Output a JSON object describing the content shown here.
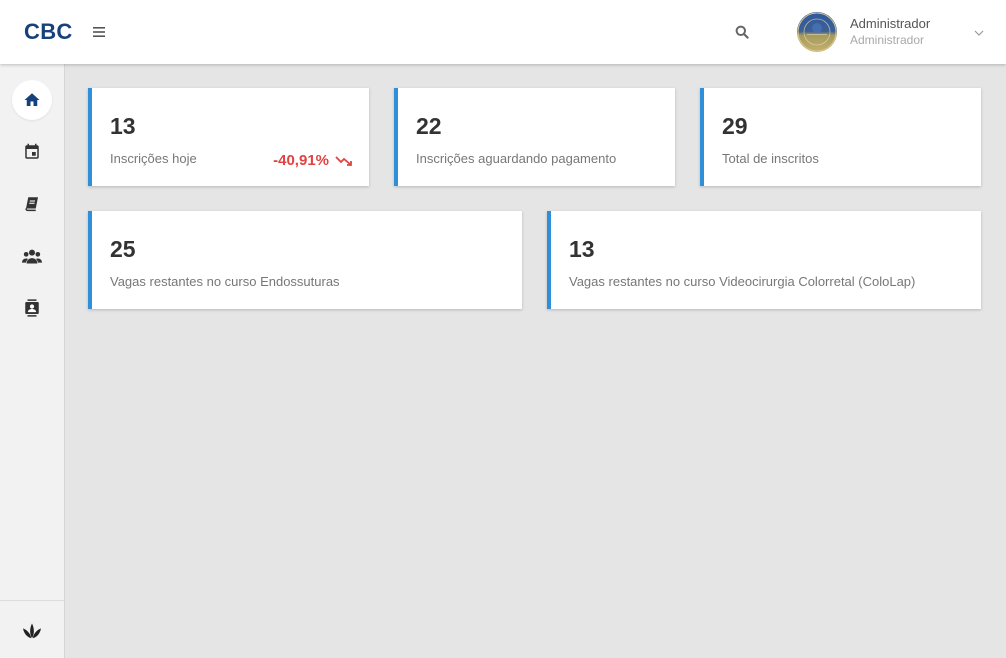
{
  "header": {
    "brand": "CBC",
    "menu_icon": "hamburger-menu-icon",
    "search_icon": "search-icon",
    "user": {
      "name": "Administrador",
      "role": "Administrador",
      "dropdown_icon": "chevron-down-icon"
    }
  },
  "sidebar": {
    "items": [
      {
        "icon": "home-icon",
        "active": true
      },
      {
        "icon": "calendar-icon",
        "active": false
      },
      {
        "icon": "book-icon",
        "active": false
      },
      {
        "icon": "people-group-icon",
        "active": false
      },
      {
        "icon": "contact-card-icon",
        "active": false
      }
    ],
    "footer_icon": "leaf-logo-icon"
  },
  "dashboard": {
    "cards": [
      {
        "value": "13",
        "label": "Inscrições hoje",
        "trend": "-40,91%",
        "trend_icon": "trending-down-icon"
      },
      {
        "value": "22",
        "label": "Inscrições aguardando pagamento"
      },
      {
        "value": "29",
        "label": "Total de inscritos"
      },
      {
        "value": "25",
        "label": "Vagas restantes no curso Endossuturas"
      },
      {
        "value": "13",
        "label": "Vagas restantes no curso Videocirurgia Colorretal (ColoLap)"
      }
    ]
  },
  "colors": {
    "brand": "#17417a",
    "accent": "#2f8fd8",
    "negative": "#e04343",
    "background": "#e5e5e5"
  }
}
